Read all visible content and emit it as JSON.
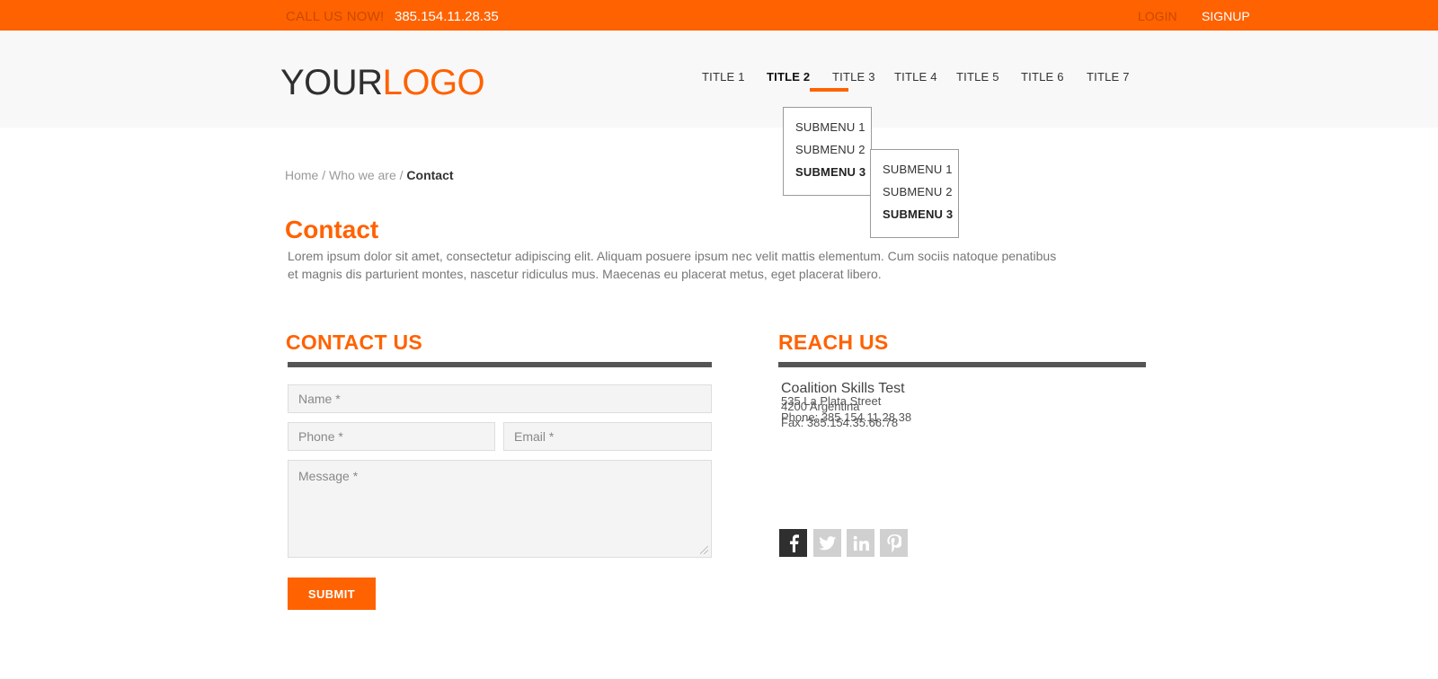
{
  "topbar": {
    "call_label": "CALL US NOW!",
    "phone": "385.154.11.28.35",
    "login": "LOGIN",
    "signup": "SIGNUP"
  },
  "logo": {
    "part1": "YOUR",
    "part2": "LOGO"
  },
  "nav": {
    "items": [
      "TITLE 1",
      "TITLE 2",
      "TITLE 3",
      "TITLE 4",
      "TITLE 5",
      "TITLE 6",
      "TITLE 7"
    ],
    "active_index": 1
  },
  "submenu_level1": {
    "items": [
      "SUBMENU 1",
      "SUBMENU 2",
      "SUBMENU 3"
    ],
    "active_index": 2
  },
  "submenu_level2": {
    "items": [
      "SUBMENU 1",
      "SUBMENU 2",
      "SUBMENU 3"
    ],
    "active_index": 2
  },
  "breadcrumb": {
    "home": "Home",
    "sep": " / ",
    "parent": "Who we are",
    "current": "Contact"
  },
  "page": {
    "title": "Contact",
    "lead": "Lorem ipsum dolor sit amet, consectetur adipiscing elit. Aliquam posuere ipsum nec velit mattis elementum. Cum sociis natoque penatibus et magnis dis parturient montes, nascetur ridiculus mus. Maecenas eu placerat metus, eget placerat libero."
  },
  "contact_form": {
    "heading": "CONTACT US",
    "name_placeholder": "Name *",
    "phone_placeholder": "Phone *",
    "email_placeholder": "Email *",
    "message_placeholder": "Message *",
    "submit_label": "SUBMIT"
  },
  "reach_us": {
    "heading": "REACH US",
    "company": "Coalition Skills Test",
    "street": "535 La Plata Street",
    "city": "4200 Argentina",
    "phone": "Phone: 385.154.11.28.38",
    "fax": "Fax: 385.154.35.66.78"
  },
  "social": [
    "facebook-icon",
    "twitter-icon",
    "linkedin-icon",
    "pinterest-icon"
  ],
  "colors": {
    "accent": "#ff6200",
    "dark": "#2f2f2f",
    "rule": "#555555",
    "muted_icon": "#d0d0d0"
  }
}
